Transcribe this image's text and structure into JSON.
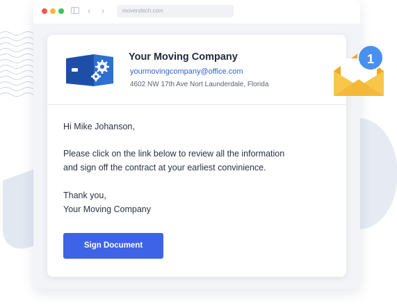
{
  "browser": {
    "address": "moverstech.com"
  },
  "email": {
    "company_name": "Your Moving Company",
    "company_email": "yourmovingcompany@office.com",
    "company_address": "4602 NW 17th Ave Nort Launderdale, Florida",
    "greeting": "Hi Mike Johanson,",
    "message_line1": "Please click on the link below to review all the information",
    "message_line2": "and sign off the contract at your earliest convinience.",
    "closing": "Thank you,",
    "signature": "Your Moving Company",
    "button_label": "Sign Document"
  },
  "notification": {
    "count": "1"
  },
  "colors": {
    "accent": "#3e63e6",
    "link": "#3560d8",
    "envelope": "#f5bb3a",
    "badge": "#4a90ef"
  }
}
